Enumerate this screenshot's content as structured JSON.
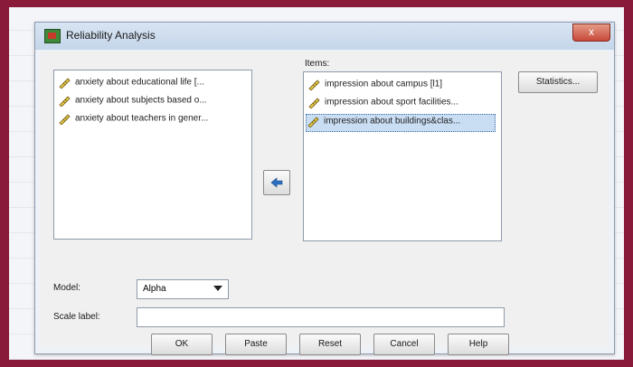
{
  "dialog": {
    "title": "Reliability Analysis",
    "close_label": "x"
  },
  "available_list": {
    "items": [
      "anxiety about educational  life [...",
      "anxiety about subjects based o...",
      "anxiety about teachers in gener..."
    ]
  },
  "items_list": {
    "label": "Items:",
    "items": [
      "impression about campus [l1]",
      "impression about sport facilities...",
      "impression about buildings&clas..."
    ],
    "selected_index": 2
  },
  "buttons": {
    "statistics": "Statistics...",
    "ok": "OK",
    "paste": "Paste",
    "reset": "Reset",
    "cancel": "Cancel",
    "help": "Help"
  },
  "model": {
    "label": "Model:",
    "selected": "Alpha"
  },
  "scale_label": {
    "label": "Scale label:",
    "value": ""
  },
  "icons": {
    "app": "spss-app-icon",
    "variable": "scale-variable-ruler-icon",
    "move": "move-arrow-icon"
  },
  "colors": {
    "frame_border": "#8a1a3a",
    "selection": "#c9ddf3",
    "arrow": "#2a6fc0"
  }
}
